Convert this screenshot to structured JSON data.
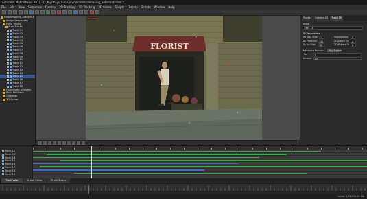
{
  "window": {
    "title": "Autodesk MatchMover 2011 - D:/Mystery/4/Gloria/project/matchmoving_autotrack.mmf *"
  },
  "menu": [
    "File",
    "Edit",
    "View",
    "Sequence",
    "Overlay",
    "2D Tracking",
    "3D Tracking",
    "3D Scene",
    "Scripts",
    "Display",
    "Scripts",
    "Window",
    "Help"
  ],
  "tree": {
    "items": [
      {
        "label": "matchmoving_autotrack",
        "type": "folder",
        "indent": 0,
        "selected": false
      },
      {
        "label": "Image Sequences",
        "type": "folder",
        "indent": 1,
        "selected": false
      },
      {
        "label": "Point Tracks",
        "type": "folder",
        "indent": 1,
        "selected": false
      },
      {
        "label": "Auto Tracks",
        "type": "folder",
        "indent": 2,
        "selected": false
      },
      {
        "label": "Track 01",
        "type": "track",
        "indent": 3,
        "selected": false
      },
      {
        "label": "Track 02",
        "type": "track",
        "indent": 3,
        "selected": false
      },
      {
        "label": "Track 03",
        "type": "track",
        "indent": 3,
        "selected": false
      },
      {
        "label": "Track 04",
        "type": "track",
        "indent": 3,
        "selected": false
      },
      {
        "label": "Track 05",
        "type": "track",
        "indent": 3,
        "selected": false
      },
      {
        "label": "Track 06",
        "type": "track",
        "indent": 3,
        "selected": false
      },
      {
        "label": "Track 07",
        "type": "track",
        "indent": 3,
        "selected": false
      },
      {
        "label": "Track 08",
        "type": "track",
        "indent": 3,
        "selected": false
      },
      {
        "label": "Track 09",
        "type": "track",
        "indent": 3,
        "selected": false
      },
      {
        "label": "Track 10",
        "type": "track",
        "indent": 3,
        "selected": false
      },
      {
        "label": "Track 11",
        "type": "track",
        "indent": 3,
        "selected": false
      },
      {
        "label": "Track 12",
        "type": "track",
        "indent": 3,
        "selected": false
      },
      {
        "label": "Track 13",
        "type": "track",
        "indent": 3,
        "selected": false
      },
      {
        "label": "Track 14",
        "type": "track",
        "indent": 3,
        "selected": false
      },
      {
        "label": "Track 15",
        "type": "track",
        "indent": 3,
        "selected": true
      },
      {
        "label": "Track 16",
        "type": "track",
        "indent": 3,
        "selected": false
      },
      {
        "label": "Track 17",
        "type": "track",
        "indent": 3,
        "selected": false
      },
      {
        "label": "Track 18",
        "type": "track",
        "indent": 3,
        "selected": false
      },
      {
        "label": "Coordinate Systems",
        "type": "folder",
        "indent": 1,
        "selected": false
      },
      {
        "label": "Point Positions",
        "type": "folder",
        "indent": 1,
        "selected": false
      },
      {
        "label": "Cameras",
        "type": "folder",
        "indent": 1,
        "selected": false
      },
      {
        "label": "3D Scene",
        "type": "folder",
        "indent": 1,
        "selected": false
      }
    ]
  },
  "viewer": {
    "frame_label": "HD 1080",
    "sign_text": "FLORIST"
  },
  "right_panel": {
    "tabs": [
      "Project",
      "Camera 02",
      "Track 15"
    ],
    "active_tab": 2,
    "name_label": "Name",
    "name_value": "Track 15",
    "section": "2D Parameters",
    "rows": [
      {
        "label": "2D Skin Step",
        "value": "1",
        "label2": "Subdivisions",
        "value2": "8"
      },
      {
        "label": "2D Predictor Resolution",
        "value": "30",
        "label2": "2D Zoom Size",
        "value2": "4"
      },
      {
        "label": "2D Up Size",
        "value": "8",
        "label2": "2D Pattern Size",
        "value2": "8"
      }
    ],
    "reference_label": "Reference Frames",
    "reference_button": "Key Frames",
    "first_label": "First",
    "first_value": "0",
    "second_label": "Second",
    "second_value": "60"
  },
  "timeline": {
    "tracks": [
      "Track 12",
      "Track 13",
      "Track 14",
      "Track 15",
      "Track 16",
      "Track 17",
      "Track 18",
      "Track 19"
    ]
  },
  "bottom_tabs": [
    "Track View",
    "Graph Editor",
    "Track Status"
  ],
  "status": {
    "text": "Cache: 109.958.0K Mb"
  }
}
